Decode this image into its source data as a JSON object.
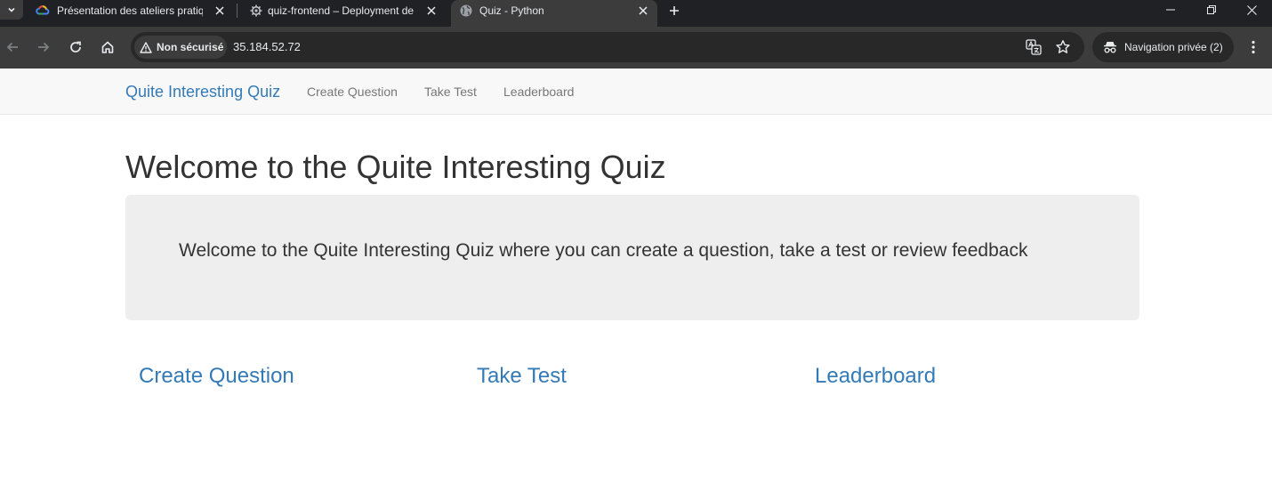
{
  "browser": {
    "tabs": [
      {
        "title": "Présentation des ateliers pratiqu",
        "icon": "google-cloud-icon",
        "active": false
      },
      {
        "title": "quiz-frontend – Deployment de",
        "icon": "gear-icon",
        "active": false
      },
      {
        "title": "Quiz - Python",
        "icon": "globe-icon",
        "active": true
      }
    ],
    "security_label": "Non sécurisé",
    "url": "35.184.52.72",
    "incognito_label": "Navigation privée (2)",
    "colors": {
      "chrome_dark": "#202124",
      "toolbar": "#3c3c3c",
      "omnibox": "#282828",
      "text": "#e8eaed"
    }
  },
  "navbar": {
    "brand": "Quite Interesting Quiz",
    "links": [
      "Create Question",
      "Take Test",
      "Leaderboard"
    ]
  },
  "main": {
    "title": "Welcome to the Quite Interesting Quiz",
    "jumbotron_text": "Welcome to the Quite Interesting Quiz where you can create a question, take a test or review feedback",
    "sections": [
      "Create Question",
      "Take Test",
      "Leaderboard"
    ]
  },
  "colors": {
    "link": "#337ab7",
    "text": "#333333",
    "navbar_bg": "#f8f8f8",
    "jumbotron_bg": "#eeeeee",
    "nav_link": "#777777"
  }
}
